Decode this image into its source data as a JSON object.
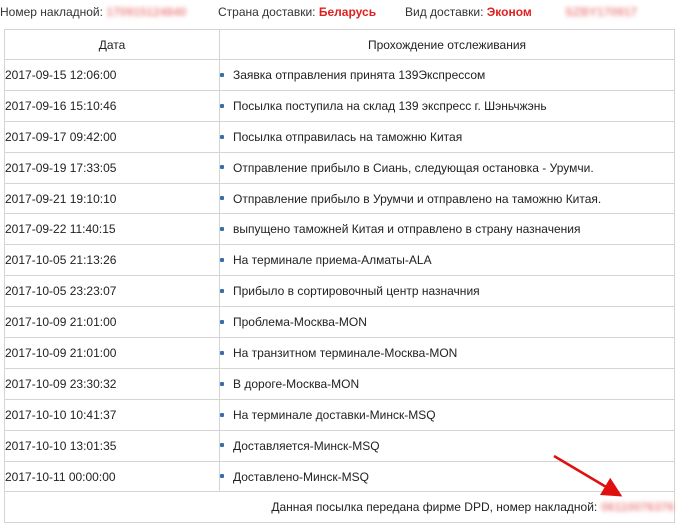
{
  "header": {
    "invoice_label": "Номер накладной:",
    "invoice_value": "170915124840",
    "country_label": "Страна доставки:",
    "country_value": "Беларусь",
    "delivery_label": "Вид доставки:",
    "delivery_value": "Эконом",
    "code_value": "SZBY170917"
  },
  "table": {
    "columns": [
      "Дата",
      "Прохождение отслеживания"
    ],
    "rows": [
      {
        "date": "2017-09-15 12:06:00",
        "status": "Заявка отправления принята 139Экспрессом"
      },
      {
        "date": "2017-09-16 15:10:46",
        "status": "Посылка поступила на склад 139 экспресс г. Шэньчжэнь"
      },
      {
        "date": "2017-09-17 09:42:00",
        "status": "Посылка отправилась на таможню Китая"
      },
      {
        "date": "2017-09-19 17:33:05",
        "status": "Отправление прибыло в Сиань, следующая остановка - Урумчи."
      },
      {
        "date": "2017-09-21 19:10:10",
        "status": "Отправление прибыло в Урумчи и отправлено на таможню Китая."
      },
      {
        "date": "2017-09-22 11:40:15",
        "status": "выпущено таможней Китая и отправлено в страну назначения"
      },
      {
        "date": "2017-10-05 21:13:26",
        "status": "На терминале приема-Алматы-ALA"
      },
      {
        "date": "2017-10-05 23:23:07",
        "status": "Прибыло в сортировочный центр назначния"
      },
      {
        "date": "2017-10-09 21:01:00",
        "status": "Проблема-Москва-MON"
      },
      {
        "date": "2017-10-09 21:01:00",
        "status": "На транзитном терминале-Москва-MON"
      },
      {
        "date": "2017-10-09 23:30:32",
        "status": "В дороге-Москва-MON"
      },
      {
        "date": "2017-10-10 10:41:37",
        "status": "На терминале доставки-Минск-MSQ"
      },
      {
        "date": "2017-10-10 13:01:35",
        "status": "Доставляется-Минск-MSQ"
      },
      {
        "date": "2017-10-11 00:00:00",
        "status": "Доставлено-Минск-MSQ"
      }
    ],
    "footer_text": "Данная посылка передана фирме DPD, номер накладной:",
    "footer_number": "06110076376"
  },
  "colors": {
    "accent_red": "#e02020",
    "bullet_blue": "#3c6fa8",
    "border": "#d4d4d4",
    "arrow_red": "#e01010"
  },
  "icons": {
    "bullet": "bullet-icon",
    "arrow": "arrow-icon"
  }
}
